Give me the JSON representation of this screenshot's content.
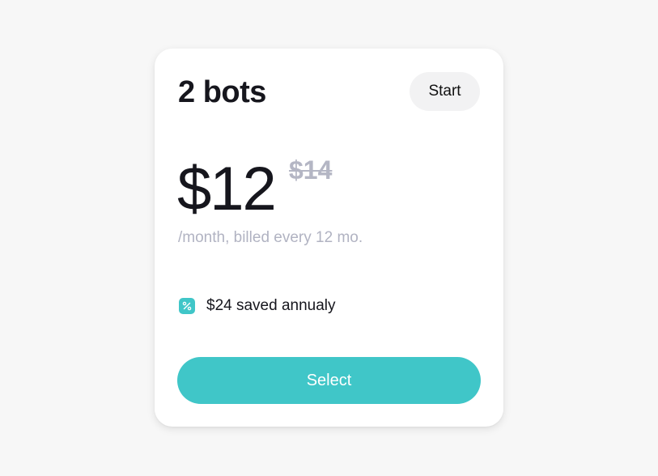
{
  "plan": {
    "title": "2 bots",
    "tag_label": "Start",
    "price": "$12",
    "old_price": "$14",
    "billing_note": "/month, billed every 12 mo.",
    "savings_text": "$24 saved annualy",
    "savings_icon": "percent-icon",
    "select_label": "Select"
  },
  "colors": {
    "accent": "#40c6c8",
    "muted": "#b4b6c4",
    "text": "#16161d",
    "background": "#f7f7f7",
    "card": "#ffffff"
  }
}
